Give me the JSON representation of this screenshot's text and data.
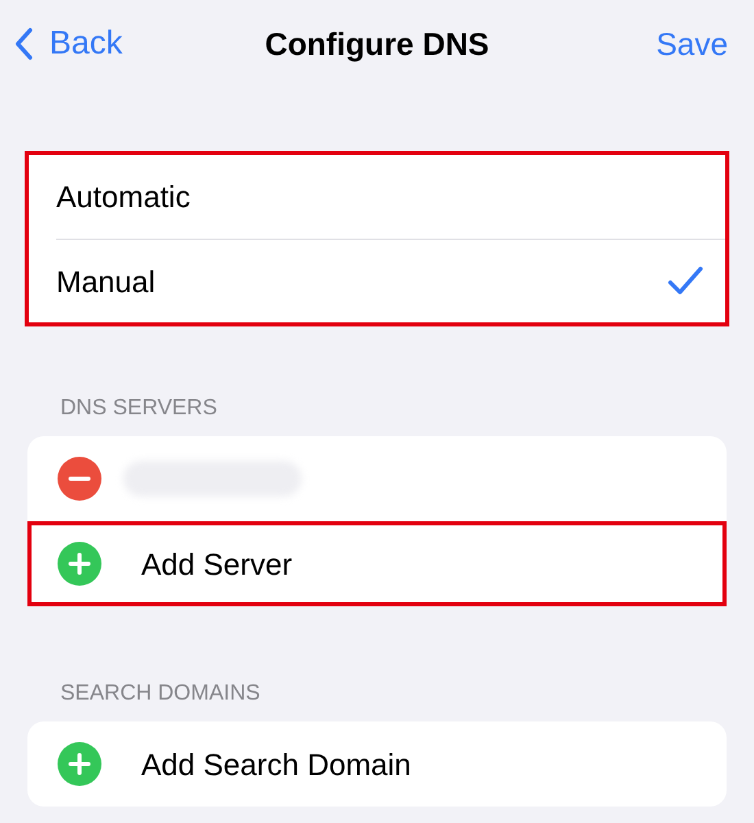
{
  "nav": {
    "back": "Back",
    "title": "Configure DNS",
    "action": "Save"
  },
  "mode": {
    "highlighted": true,
    "options": [
      {
        "label": "Automatic",
        "selected": false
      },
      {
        "label": "Manual",
        "selected": true
      }
    ]
  },
  "sections": [
    {
      "header": "DNS SERVERS",
      "rows": [
        {
          "kind": "remove",
          "highlighted": false
        },
        {
          "kind": "add",
          "label": "Add Server",
          "highlighted": true
        }
      ]
    },
    {
      "header": "SEARCH DOMAINS",
      "rows": [
        {
          "kind": "add",
          "label": "Add Search Domain",
          "highlighted": false
        }
      ]
    }
  ]
}
